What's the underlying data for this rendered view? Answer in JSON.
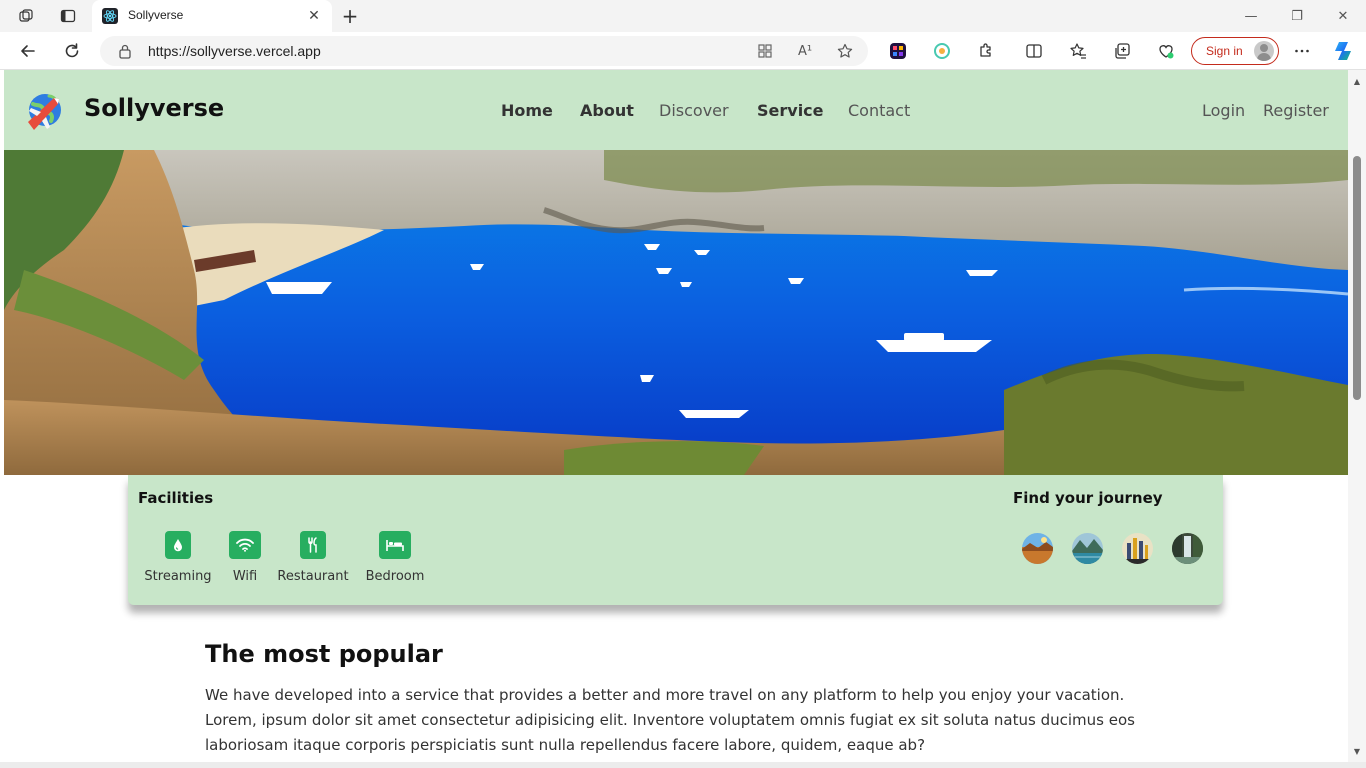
{
  "browser": {
    "tab_title": "Sollyverse",
    "tab_close": "✕",
    "new_tab": "+",
    "url": "https://sollyverse.vercel.app",
    "read_aloud": "A¹",
    "sign_in": "Sign in",
    "window_controls": {
      "minimize": "—",
      "restore": "❐",
      "close": "✕"
    },
    "icons": [
      "workspaces-icon",
      "tab-actions-icon",
      "back-icon",
      "refresh-icon",
      "lock-icon",
      "app-available-icon",
      "read-aloud-icon",
      "favorite-star-icon",
      "extension-1-icon",
      "extension-2-icon",
      "extensions-icon",
      "split-screen-icon",
      "favorites-icon",
      "collections-icon",
      "browser-essentials-icon",
      "more-icon",
      "copilot-icon"
    ]
  },
  "site": {
    "brand": "Sollyverse",
    "menu": [
      "Home",
      "About",
      "Discover",
      "Service",
      "Contact"
    ],
    "auth": {
      "login": "Login",
      "register": "Register"
    },
    "accent": "#27ae60",
    "header_bg": "#c8e6c9"
  },
  "facilities": {
    "title": "Facilities",
    "items": [
      {
        "label": "Streaming",
        "icon": "water-drop-icon"
      },
      {
        "label": "Wifi",
        "icon": "wifi-icon"
      },
      {
        "label": "Restaurant",
        "icon": "restaurant-icon"
      },
      {
        "label": "Bedroom",
        "icon": "bed-icon"
      }
    ]
  },
  "journey": {
    "title": "Find your journey",
    "thumbnails": [
      "desert-thumbnail",
      "mountain-lake-thumbnail",
      "city-thumbnail",
      "waterfall-thumbnail"
    ]
  },
  "popular": {
    "title": "The most popular",
    "body": "We have developed into a service that provides a better and more travel on any platform to help you enjoy your vacation. Lorem, ipsum dolor sit amet consectetur adipisicing elit. Inventore voluptatem omnis fugiat ex sit soluta natus ducimus eos laboriosam itaque corporis perspiciatis sunt nulla repellendus facere labore, quidem, eaque ab?"
  }
}
